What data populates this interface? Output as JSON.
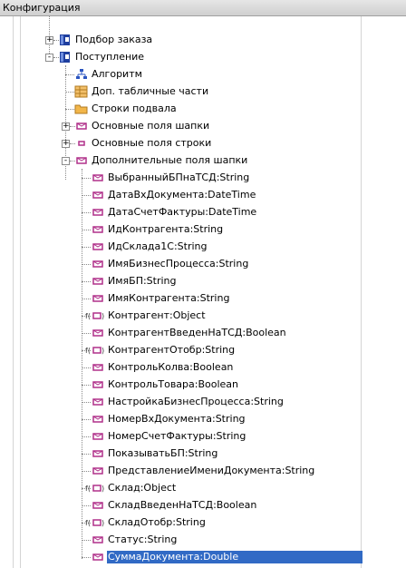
{
  "window": {
    "title": "Конфигурация"
  },
  "tree": {
    "nodes": [
      {
        "label": "Подбор заказа",
        "level": 0,
        "expander": "+",
        "icon": "book-icon"
      },
      {
        "label": "Поступление",
        "level": 0,
        "expander": "-",
        "icon": "book-icon"
      },
      {
        "label": "Алгоритм",
        "level": 1,
        "expander": "",
        "icon": "algorithm-icon"
      },
      {
        "label": "Доп. табличные части",
        "level": 1,
        "expander": "",
        "icon": "table-icon"
      },
      {
        "label": "Строки подвала",
        "level": 1,
        "expander": "",
        "icon": "folder-icon"
      },
      {
        "label": "Основные поля шапки",
        "level": 1,
        "expander": "+",
        "icon": "field-icon"
      },
      {
        "label": "Основные поля строки",
        "level": 1,
        "expander": "+",
        "icon": "small-field-icon"
      },
      {
        "label": "Дополнительные поля шапки",
        "level": 1,
        "expander": "-",
        "icon": "field-icon"
      },
      {
        "label": "ВыбранныйБПнаТСД:String",
        "level": 2,
        "expander": "",
        "icon": "field-icon"
      },
      {
        "label": "ДатаВхДокумента:DateTime",
        "level": 2,
        "expander": "",
        "icon": "field-icon"
      },
      {
        "label": "ДатаСчетФактуры:DateTime",
        "level": 2,
        "expander": "",
        "icon": "field-icon"
      },
      {
        "label": "ИдКонтрагента:String",
        "level": 2,
        "expander": "",
        "icon": "field-icon"
      },
      {
        "label": "ИдСклада1С:String",
        "level": 2,
        "expander": "",
        "icon": "field-icon"
      },
      {
        "label": "ИмяБизнесПроцесса:String",
        "level": 2,
        "expander": "",
        "icon": "field-icon"
      },
      {
        "label": "ИмяБП:String",
        "level": 2,
        "expander": "",
        "icon": "field-icon"
      },
      {
        "label": "ИмяКонтрагента:String",
        "level": 2,
        "expander": "",
        "icon": "field-icon"
      },
      {
        "label": "Контрагент:Object",
        "level": 2,
        "expander": "",
        "icon": "function-field-icon"
      },
      {
        "label": "КонтрагентВведенНаТСД:Boolean",
        "level": 2,
        "expander": "",
        "icon": "field-icon"
      },
      {
        "label": "КонтрагентОтобр:String",
        "level": 2,
        "expander": "",
        "icon": "function-field-icon"
      },
      {
        "label": "КонтрольКолва:Boolean",
        "level": 2,
        "expander": "",
        "icon": "field-icon"
      },
      {
        "label": "КонтрольТовара:Boolean",
        "level": 2,
        "expander": "",
        "icon": "field-icon"
      },
      {
        "label": "НастройкаБизнесПроцесса:String",
        "level": 2,
        "expander": "",
        "icon": "field-icon"
      },
      {
        "label": "НомерВхДокумента:String",
        "level": 2,
        "expander": "",
        "icon": "field-icon"
      },
      {
        "label": "НомерСчетФактуры:String",
        "level": 2,
        "expander": "",
        "icon": "field-icon"
      },
      {
        "label": "ПоказыватьБП:String",
        "level": 2,
        "expander": "",
        "icon": "field-icon"
      },
      {
        "label": "ПредставлениеИмениДокумента:String",
        "level": 2,
        "expander": "",
        "icon": "field-icon"
      },
      {
        "label": "Склад:Object",
        "level": 2,
        "expander": "",
        "icon": "function-field-icon"
      },
      {
        "label": "СкладВведенНаТСД:Boolean",
        "level": 2,
        "expander": "",
        "icon": "field-icon"
      },
      {
        "label": "СкладОтобр:String",
        "level": 2,
        "expander": "",
        "icon": "function-field-icon"
      },
      {
        "label": "Статус:String",
        "level": 2,
        "expander": "",
        "icon": "field-icon"
      },
      {
        "label": "СуммаДокумента:Double",
        "level": 2,
        "expander": "",
        "icon": "field-icon",
        "selected": true
      }
    ]
  },
  "colors": {
    "selection": "#316ac5",
    "field_icon": "#b0308a",
    "book_icon": "#1f3f9f"
  }
}
